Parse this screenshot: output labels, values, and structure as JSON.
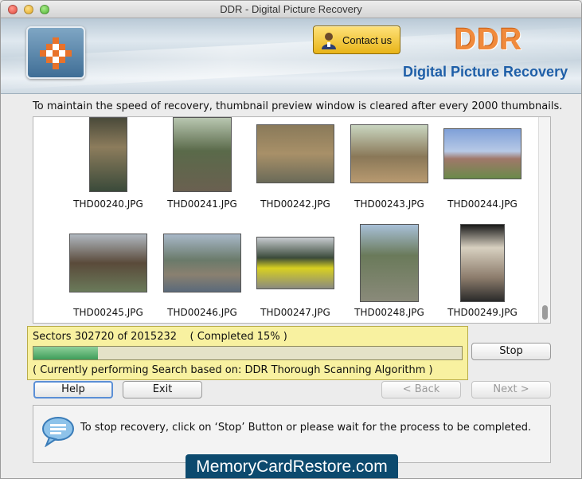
{
  "window": {
    "title": "DDR - Digital Picture Recovery"
  },
  "header": {
    "contact_label": "Contact us",
    "brand": "DDR",
    "product": "Digital Picture Recovery",
    "brand_color": "#f08a3c",
    "product_color": "#1f5fa8"
  },
  "info_text": "To maintain the speed of recovery, thumbnail preview window is cleared after every 2000 thumbnails.",
  "thumbnails": [
    {
      "name": "THD00240.JPG",
      "icon": "auto-rickshaw-interior-photo"
    },
    {
      "name": "THD00241.JPG",
      "icon": "elephant-photo"
    },
    {
      "name": "THD00242.JPG",
      "icon": "temple-ruins-photo"
    },
    {
      "name": "THD00243.JPG",
      "icon": "tree-photo"
    },
    {
      "name": "THD00244.JPG",
      "icon": "palace-photo"
    },
    {
      "name": "THD00245.JPG",
      "icon": "boat-people-photo"
    },
    {
      "name": "THD00246.JPG",
      "icon": "river-town-photo"
    },
    {
      "name": "THD00247.JPG",
      "icon": "rickshaw-photo"
    },
    {
      "name": "THD00248.JPG",
      "icon": "person-mountain-photo"
    },
    {
      "name": "THD00249.JPG",
      "icon": "building-courtyard-photo"
    }
  ],
  "progress": {
    "sectors_text": "Sectors 302720 of 2015232    ( Completed 15% )",
    "fraction": 0.15,
    "algorithm_text": "( Currently performing Search based on: DDR Thorough Scanning Algorithm )"
  },
  "buttons": {
    "stop": "Stop",
    "help": "Help",
    "exit": "Exit",
    "back": "< Back",
    "next": "Next >"
  },
  "status_message": "To stop recovery, click on ‘Stop’ Button or please wait for the process to be completed.",
  "watermark": "MemoryCardRestore.com"
}
